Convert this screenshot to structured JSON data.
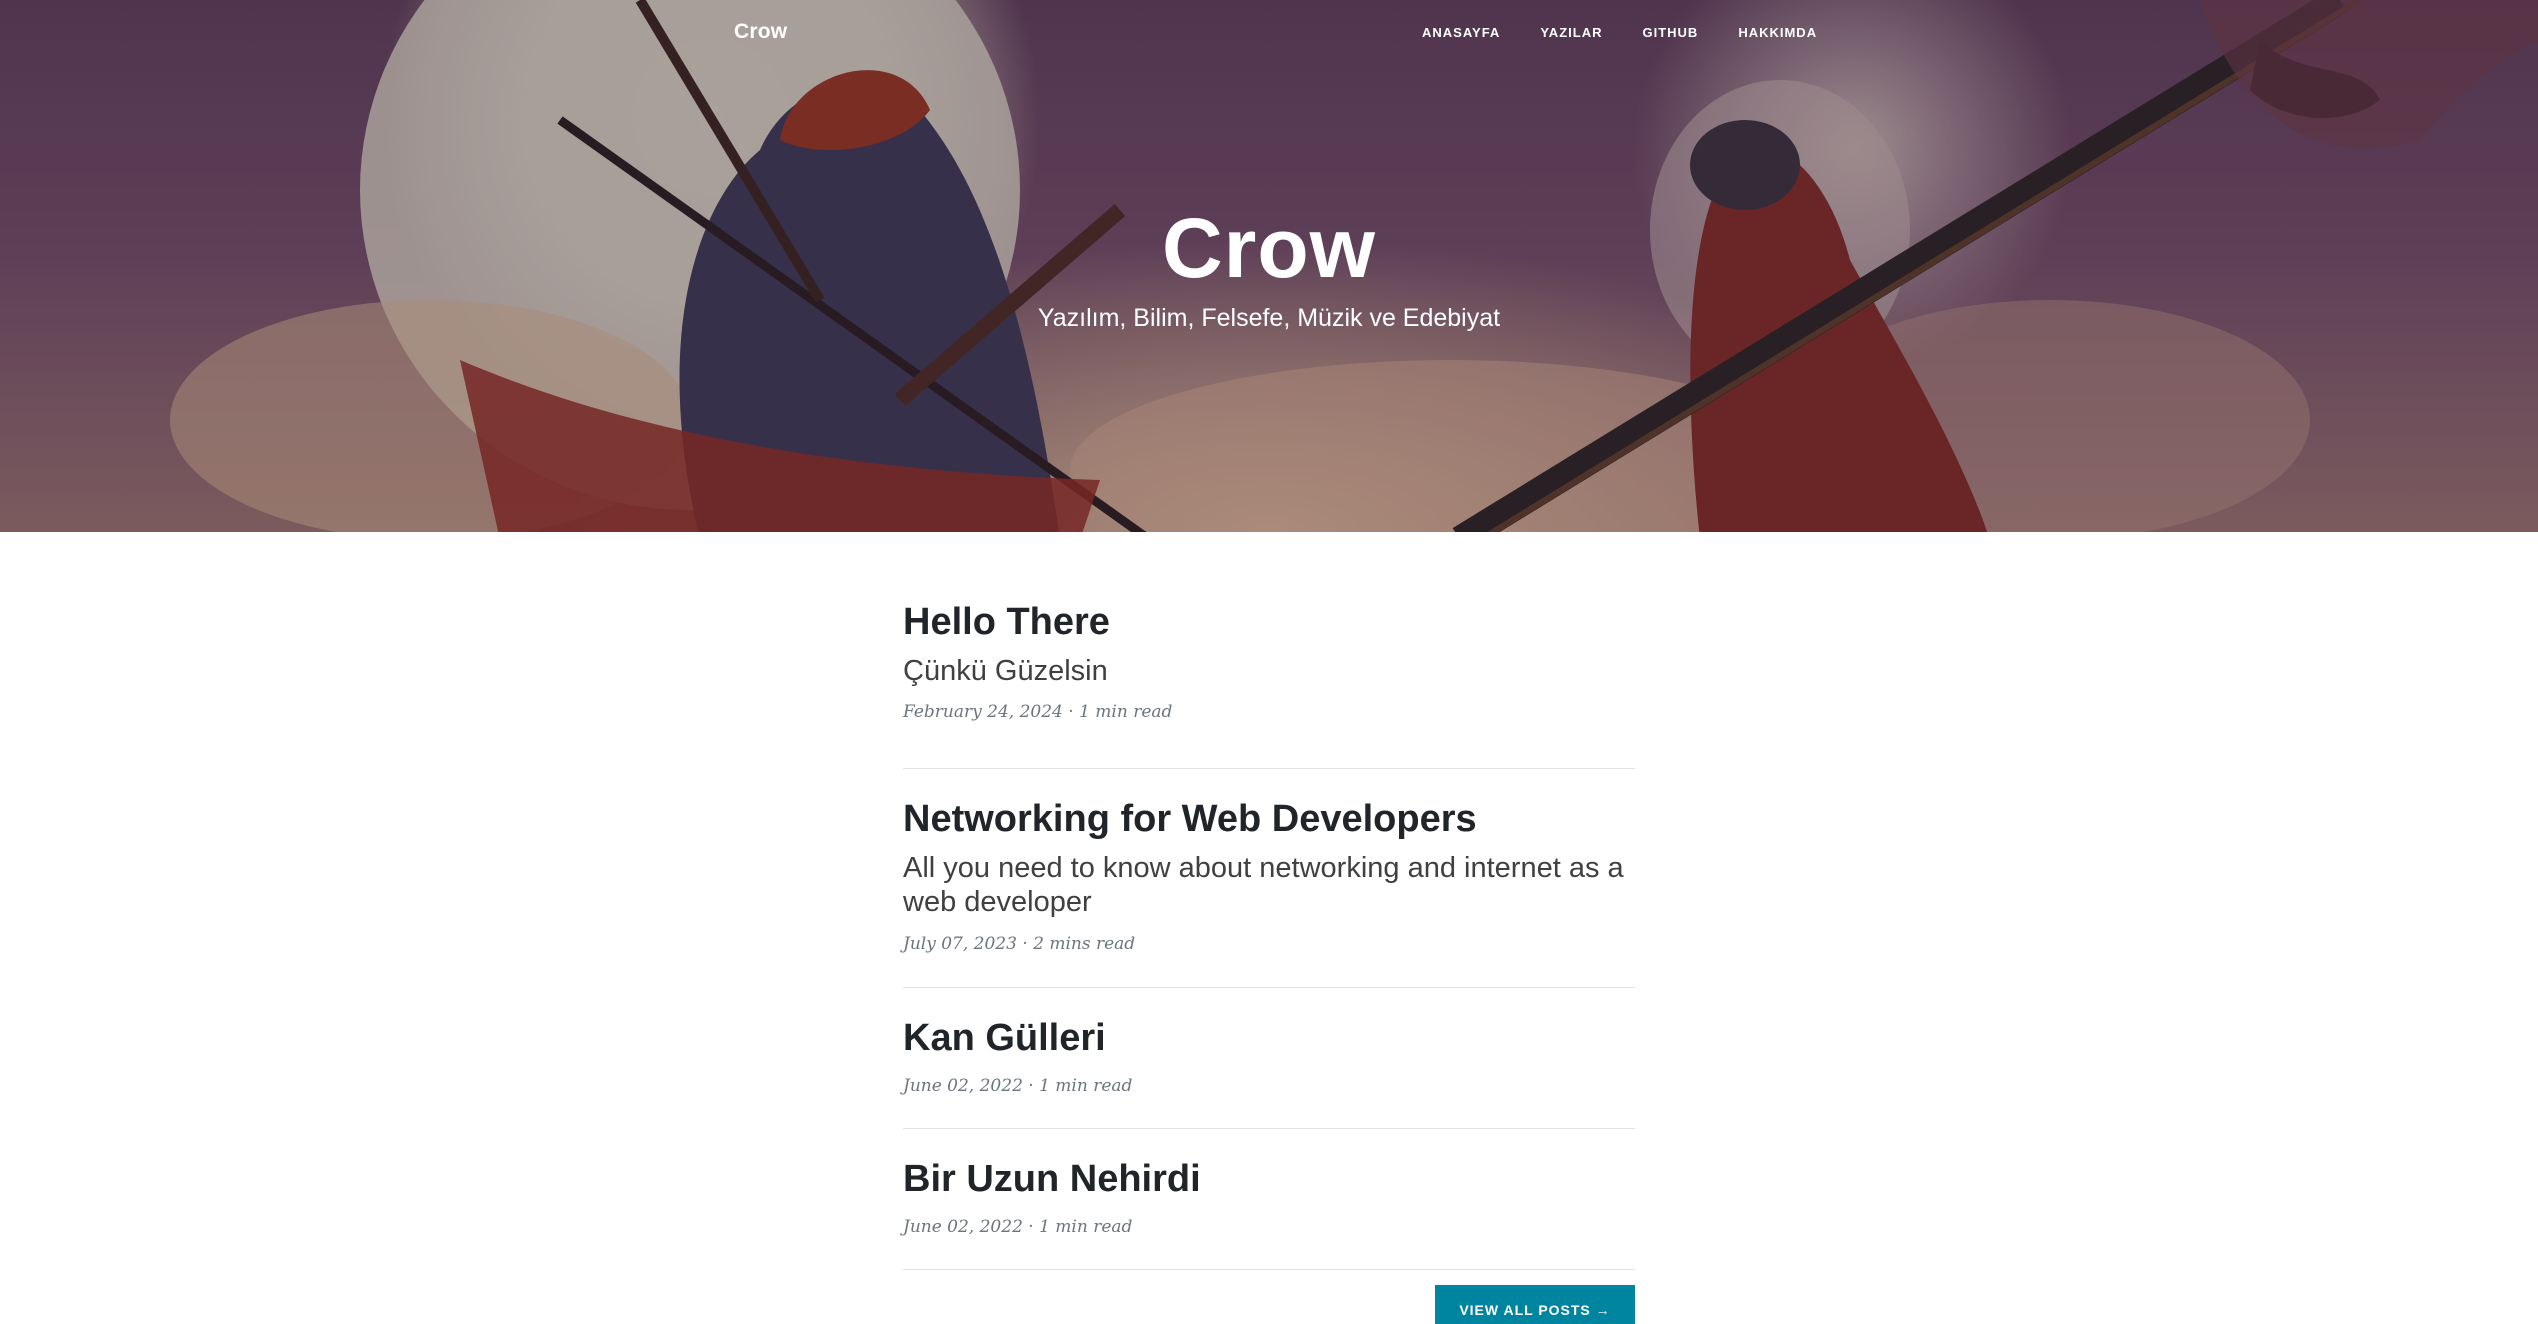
{
  "nav": {
    "brand": "Crow",
    "links": [
      "ANASAYFA",
      "YAZILAR",
      "GITHUB",
      "HAKKIMDA"
    ]
  },
  "hero": {
    "title": "Crow",
    "subtitle": "Yazılım, Bilim, Felsefe, Müzik ve Edebiyat"
  },
  "posts": [
    {
      "title": "Hello There",
      "subtitle": "Çünkü Güzelsin",
      "meta": "February 24, 2024 · 1 min read"
    },
    {
      "title": "Networking for Web Developers",
      "subtitle": "All you need to know about networking and internet as a web developer",
      "meta": "July 07, 2023 · 2 mins read"
    },
    {
      "title": "Kan Gülleri",
      "subtitle": "",
      "meta": "June 02, 2022 · 1 min read"
    },
    {
      "title": "Bir Uzun Nehirdi",
      "subtitle": "",
      "meta": "June 02, 2022 · 1 min read"
    }
  ],
  "view_all_label": "VIEW ALL POSTS →",
  "colors": {
    "accent": "#0085a1",
    "text": "#212529",
    "meta": "#6c757d"
  }
}
